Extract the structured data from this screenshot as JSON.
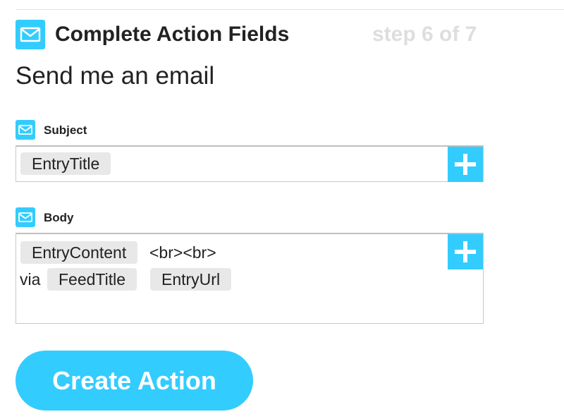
{
  "header": {
    "title": "Complete Action Fields",
    "step": "step 6 of 7",
    "icon": "mail-icon"
  },
  "action_name": "Send me an email",
  "fields": {
    "subject": {
      "label": "Subject",
      "icon": "mail-icon",
      "tokens": [
        "EntryTitle"
      ]
    },
    "body": {
      "label": "Body",
      "icon": "mail-icon",
      "line1_token": "EntryContent",
      "line1_text": "<br><br>",
      "line2_text": "via",
      "line2_tokens": [
        "FeedTitle",
        "EntryUrl"
      ]
    }
  },
  "add_ingredient_icon": "plus-icon",
  "create_button_label": "Create Action",
  "colors": {
    "accent": "#33ccff",
    "step_text": "#dedede",
    "token_bg": "#e8e8e8"
  }
}
